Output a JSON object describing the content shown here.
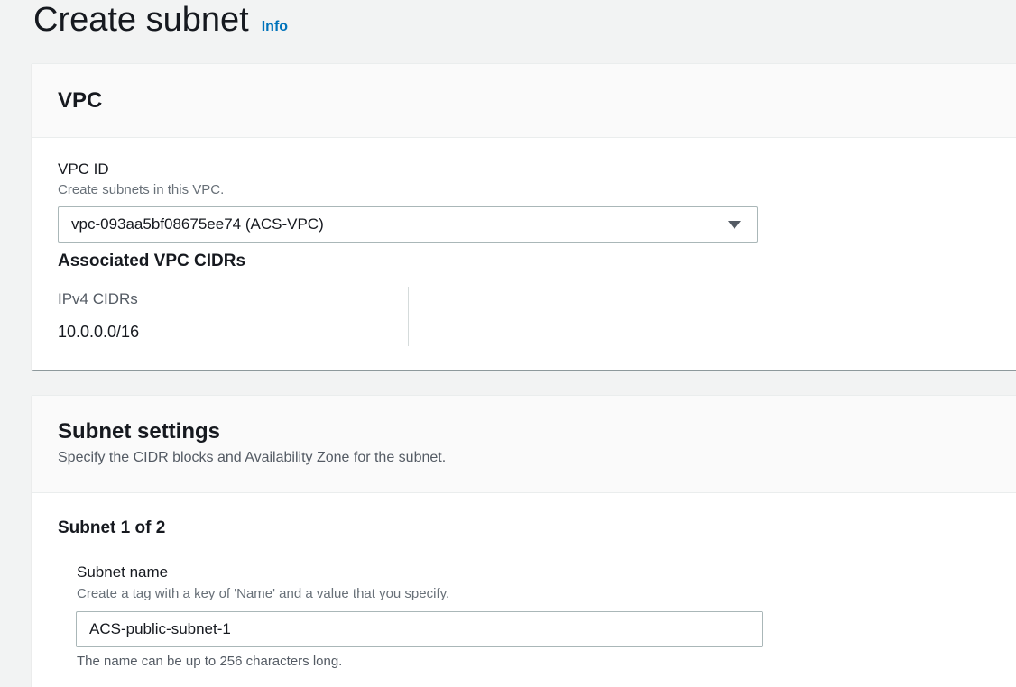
{
  "page": {
    "title": "Create subnet",
    "info_link": "Info"
  },
  "vpc_panel": {
    "heading": "VPC",
    "vpc_id": {
      "label": "VPC ID",
      "description": "Create subnets in this VPC.",
      "selected_value": "vpc-093aa5bf08675ee74 (ACS-VPC)"
    },
    "associated_cidrs": {
      "heading": "Associated VPC CIDRs",
      "ipv4_label": "IPv4 CIDRs",
      "ipv4_value": "10.0.0.0/16"
    }
  },
  "subnet_panel": {
    "heading": "Subnet settings",
    "description": "Specify the CIDR blocks and Availability Zone for the subnet.",
    "subnet_counter": "Subnet 1 of 2",
    "subnet_name": {
      "label": "Subnet name",
      "description": "Create a tag with a key of 'Name' and a value that you specify.",
      "value": "ACS-public-subnet-1",
      "constraint": "The name can be up to 256 characters long."
    }
  },
  "colors": {
    "link": "#0073bb",
    "page_background": "#f2f3f3",
    "panel_header_background": "#fafafa",
    "text": "#16191f",
    "secondary_text": "#545b64"
  },
  "icons": {
    "select_caret": "caret-down-icon"
  }
}
